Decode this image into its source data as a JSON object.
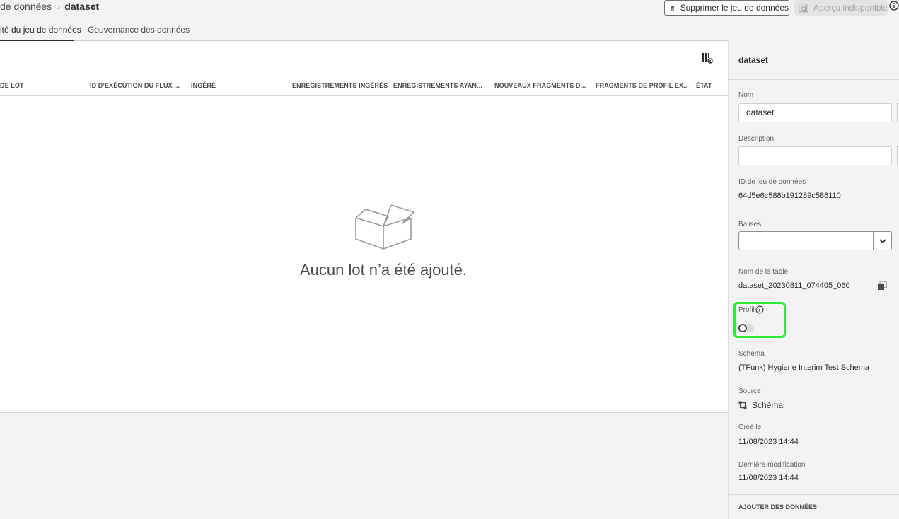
{
  "breadcrumb": {
    "parent": "de données",
    "current": "dataset"
  },
  "actions": {
    "delete_label": "Supprimer le jeu de données",
    "preview_label": "Aperçu indisponible"
  },
  "tabs": [
    {
      "label": "ité du jeu de données"
    },
    {
      "label": "Gouvernance des données"
    }
  ],
  "table": {
    "columns": [
      "DE LOT",
      "ID D’EXÉCUTION DU FLUX ...",
      "INGÉRÉ",
      "ENREGISTREMENTS INGÉRÉS",
      "ENREGISTREMENTS AYAN...",
      "NOUVEAUX FRAGMENTS D...",
      "FRAGMENTS DE PROFIL EX...",
      "ÉTAT"
    ],
    "empty_message": "Aucun lot n’a été ajouté."
  },
  "side": {
    "title": "dataset",
    "name": {
      "label": "Nom",
      "value": "dataset"
    },
    "description": {
      "label": "Description",
      "value": ""
    },
    "dataset_id": {
      "label": "ID de jeu de données",
      "value": "64d5e6c588b191289c586110"
    },
    "tags": {
      "label": "Balises",
      "value": ""
    },
    "table_name": {
      "label": "Nom de la table",
      "value": "dataset_20230811_074405_060"
    },
    "profile": {
      "label": "Profil",
      "enabled": false
    },
    "schema": {
      "label": "Schéma",
      "value": "(TFunk) Hygiene Interim Test Schema"
    },
    "source": {
      "label": "Source",
      "value": "Schéma"
    },
    "created": {
      "label": "Créé le",
      "value": "11/08/2023 14:44"
    },
    "modified": {
      "label": "Dernière modification",
      "value": "11/08/2023 14:44"
    },
    "add_data": {
      "label": "AJOUTER DES DONNÉES"
    }
  },
  "colors": {
    "highlight": "#2bea3a"
  }
}
